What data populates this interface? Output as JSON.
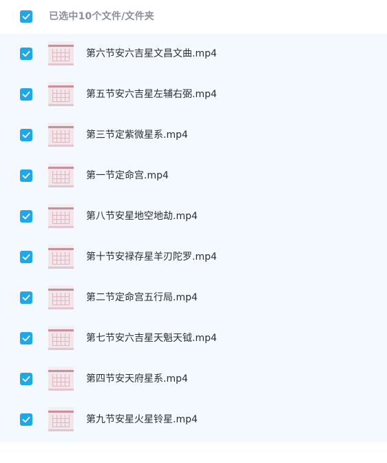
{
  "header": {
    "selection_label": "已选中10个文件/文件夹"
  },
  "colors": {
    "accent": "#1fa8e8",
    "list_background": "#f3f9fe",
    "thumbnail_pink": "#c8909f"
  },
  "files": [
    {
      "name": "第六节安六吉星文昌文曲.mp4",
      "checked": true,
      "icon": "video-thumbnail-icon"
    },
    {
      "name": "第五节安六吉星左辅右弼.mp4",
      "checked": true,
      "icon": "video-thumbnail-icon"
    },
    {
      "name": "第三节定紫微星系.mp4",
      "checked": true,
      "icon": "video-thumbnail-icon"
    },
    {
      "name": "第一节定命宫.mp4",
      "checked": true,
      "icon": "video-thumbnail-icon"
    },
    {
      "name": "第八节安星地空地劫.mp4",
      "checked": true,
      "icon": "video-thumbnail-icon"
    },
    {
      "name": "第十节安禄存星羊刃陀罗.mp4",
      "checked": true,
      "icon": "video-thumbnail-icon"
    },
    {
      "name": "第二节定命宫五行局.mp4",
      "checked": true,
      "icon": "video-thumbnail-icon"
    },
    {
      "name": "第七节安六吉星天魁天钺.mp4",
      "checked": true,
      "icon": "video-thumbnail-icon"
    },
    {
      "name": "第四节安天府星系.mp4",
      "checked": true,
      "icon": "video-thumbnail-icon"
    },
    {
      "name": "第九节安星火星铃星.mp4",
      "checked": true,
      "icon": "video-thumbnail-icon"
    }
  ]
}
